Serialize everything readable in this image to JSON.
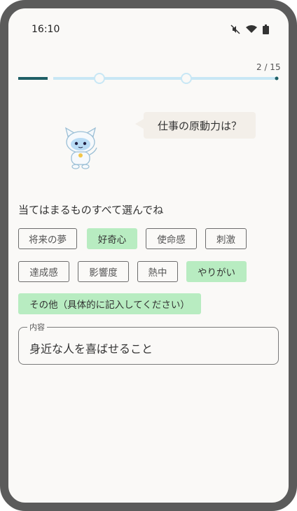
{
  "status_bar": {
    "time": "16:10",
    "icons": [
      "mute-icon",
      "wifi-icon",
      "battery-icon"
    ]
  },
  "progress": {
    "counter": "2 / 15",
    "fraction": 0.133,
    "accent": "#1f5f66",
    "track": "#c8e7f5"
  },
  "question": {
    "text": "仕事の原動力は？"
  },
  "instruction": "当てはまるものすべて選んでね",
  "chips": [
    {
      "label": "将来の夢",
      "selected": false
    },
    {
      "label": "好奇心",
      "selected": true
    },
    {
      "label": "使命感",
      "selected": false
    },
    {
      "label": "刺激",
      "selected": false
    },
    {
      "label": "達成感",
      "selected": false
    },
    {
      "label": "影響度",
      "selected": false
    },
    {
      "label": "熱中",
      "selected": false
    },
    {
      "label": "やりがい",
      "selected": true
    },
    {
      "label": "その他（具体的に記入してください）",
      "selected": true
    }
  ],
  "input": {
    "label": "内容",
    "value": "身近な人を喜ばせること"
  },
  "colors": {
    "selected_chip": "#b8ecc1",
    "background": "#faf9f7"
  }
}
